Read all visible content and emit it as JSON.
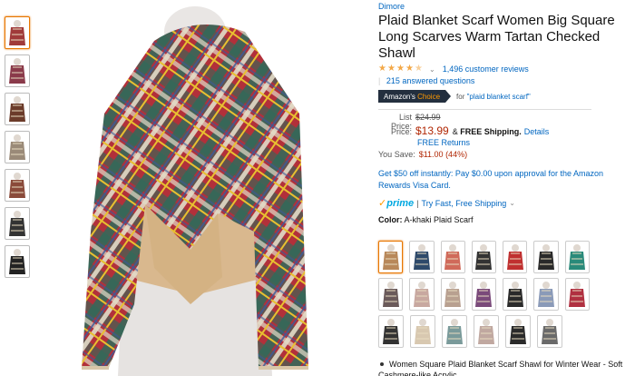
{
  "product": {
    "brand": "Dimore",
    "title": "Plaid Blanket Scarf Women Big Square Long Scarves Warm Tartan Checked Shawl",
    "rating_stars": 4.5,
    "reviews": "1,496 customer reviews",
    "answered": "215 answered questions",
    "badge": {
      "prefix": "Amazon's",
      "choice": "Choice"
    },
    "badge_for": "for",
    "badge_query": "\"plaid blanket scarf\""
  },
  "price": {
    "list_label": "List Price:",
    "list_value": "$24.99",
    "price_label": "Price:",
    "price_value": "$13.99",
    "shipping_prefix": "&",
    "shipping": "FREE Shipping.",
    "details": "Details",
    "returns": "FREE Returns",
    "save_label": "You Save:",
    "save_value": "$11.00 (44%)"
  },
  "promo": "Get $50 off instantly: Pay $0.00 upon approval for the Amazon Rewards Visa Card.",
  "prime": {
    "check": "✓",
    "word": "prime",
    "sep": "|",
    "link": "Try Fast, Free Shipping"
  },
  "color": {
    "label": "Color:",
    "value": "A-khaki Plaid Scarf"
  },
  "thumbnails": [
    {
      "name": "thumb-1",
      "color": "#a03a3a"
    },
    {
      "name": "thumb-2",
      "color": "#8a3a4a"
    },
    {
      "name": "thumb-3",
      "color": "#6b3b2a"
    },
    {
      "name": "thumb-4",
      "color": "#9a8a78"
    },
    {
      "name": "thumb-5",
      "color": "#8a4a3a"
    },
    {
      "name": "thumb-6",
      "color": "#333333"
    },
    {
      "name": "thumb-7",
      "color": "#222222"
    }
  ],
  "swatches": [
    [
      "#b8885a",
      "#2e4a6b",
      "#d06a5a",
      "#333333",
      "#c03030",
      "#2a2a2a",
      "#2a8a7a"
    ],
    [
      "#6a5a5a",
      "#c8a8a0",
      "#b8a090",
      "#7a4a7a",
      "#2a2a2a",
      "#8a9ab8",
      "#b03040"
    ],
    [
      "#333333",
      "#d8c8b0",
      "#7a9a9a",
      "#c0a8a0",
      "#2a2a2a",
      "#6a6a6a"
    ]
  ],
  "bullet": "Women Square Plaid Blanket Scarf Shawl for Winter Wear - Soft Cashmere-like Acrylic"
}
